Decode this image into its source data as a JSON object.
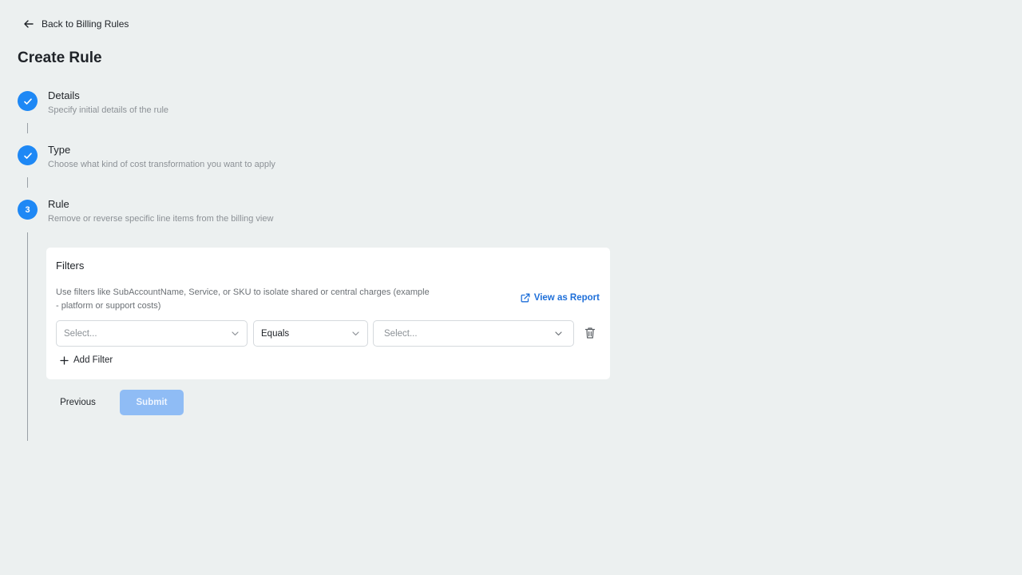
{
  "nav": {
    "back_label": "Back to Billing Rules"
  },
  "page": {
    "title": "Create Rule"
  },
  "steps": [
    {
      "marker": "check",
      "title": "Details",
      "subtitle": "Specify initial details of the rule"
    },
    {
      "marker": "check",
      "title": "Type",
      "subtitle": "Choose what kind of cost transformation you want to apply"
    },
    {
      "marker": "3",
      "title": "Rule",
      "subtitle": "Remove or reverse specific line items from the billing view"
    }
  ],
  "filters": {
    "title": "Filters",
    "description": "Use filters like SubAccountName, Service, or SKU to isolate shared or central charges (example - platform or support costs)",
    "view_report_label": "View as Report",
    "rows": [
      {
        "field_placeholder": "Select...",
        "operator": "Equals",
        "value_placeholder": "Select..."
      }
    ],
    "add_filter_label": "Add Filter"
  },
  "actions": {
    "previous_label": "Previous",
    "submit_label": "Submit"
  },
  "colors": {
    "accent": "#1e88f5",
    "link": "#1e6fd9",
    "submit_disabled": "#8fbcf5",
    "background": "#ecf0f0"
  }
}
